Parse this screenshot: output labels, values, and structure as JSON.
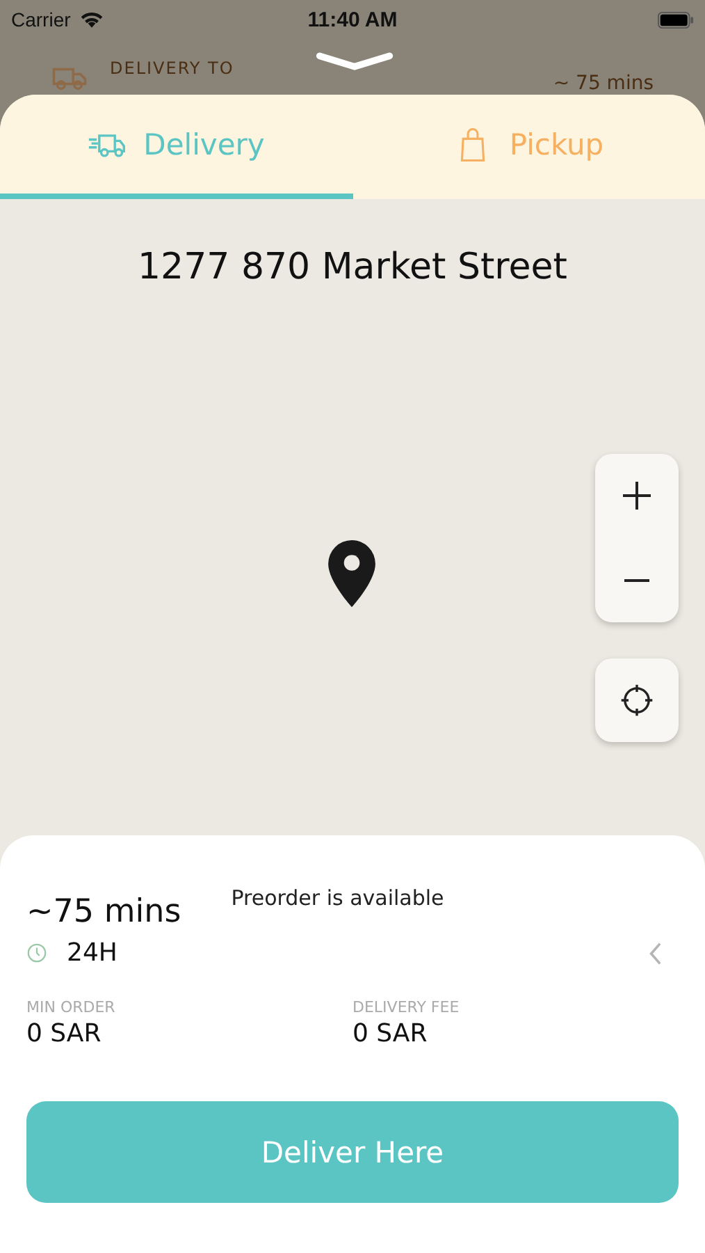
{
  "status_bar": {
    "carrier": "Carrier",
    "time": "11:40 AM"
  },
  "behind_header": {
    "label": "DELIVERY TO",
    "eta": "~ 75 mins"
  },
  "tabs": [
    {
      "label": "Delivery",
      "kind": "delivery",
      "selected": true
    },
    {
      "label": "Pickup",
      "kind": "pickup",
      "selected": false
    }
  ],
  "map": {
    "address": "1277 870 Market Street"
  },
  "info": {
    "eta": "~75 mins",
    "preorder": "Preorder is available",
    "hours": "24H",
    "stats": [
      {
        "label": "MIN ORDER",
        "value": "0 SAR"
      },
      {
        "label": "DELIVERY FEE",
        "value": "0 SAR"
      }
    ]
  },
  "action_button": "Deliver Here"
}
